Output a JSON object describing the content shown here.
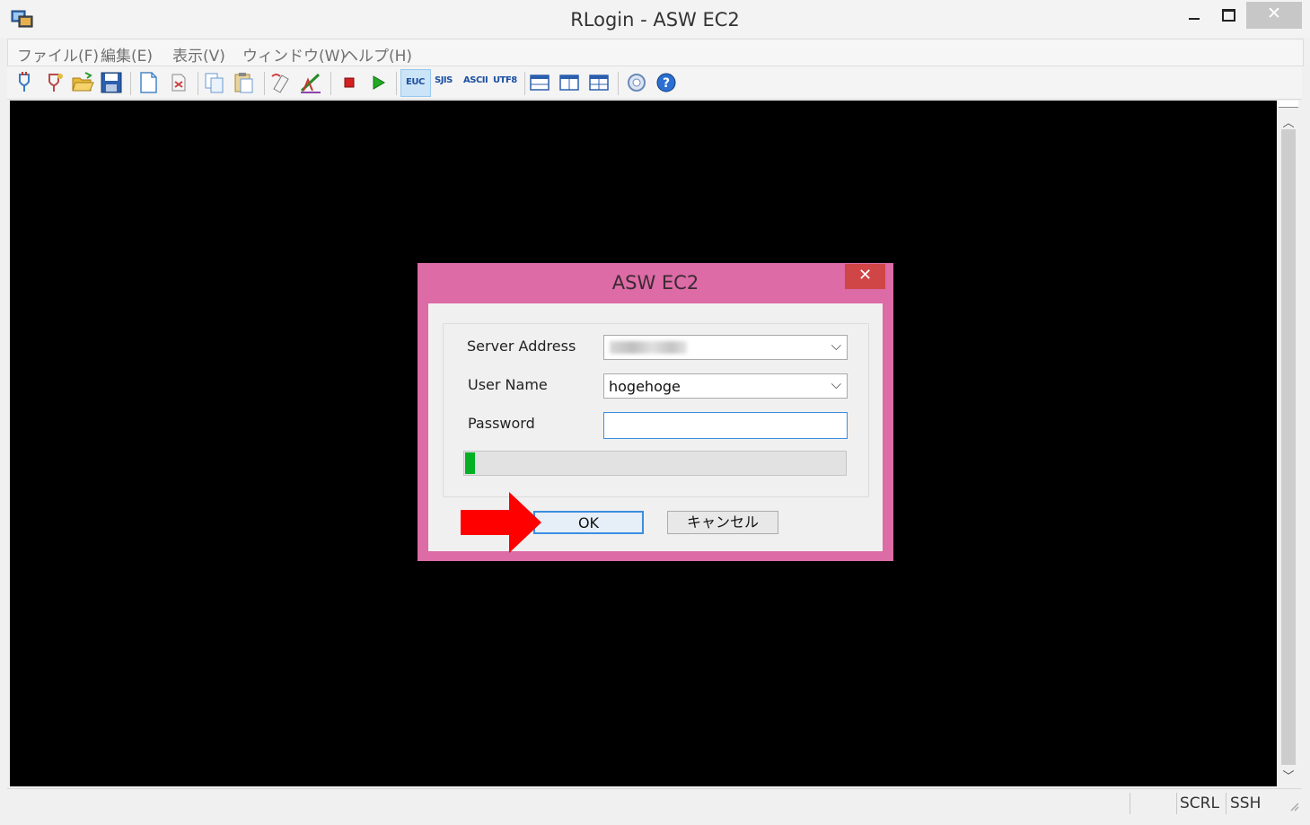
{
  "window": {
    "title": "RLogin - ASW EC2",
    "close_glyph": "✕"
  },
  "menu": [
    {
      "label": "ファイル(F)"
    },
    {
      "label": "編集(E)"
    },
    {
      "label": "表示(V)"
    },
    {
      "label": "ウィンドウ(W)"
    },
    {
      "label": "ヘルプ(H)"
    }
  ],
  "toolbar": {
    "encodings": [
      "EUC",
      "SJIS",
      "ASCII",
      "UTF8"
    ],
    "active_encoding": "EUC"
  },
  "statusbar": {
    "scroll": "SCRL",
    "protocol": "SSH"
  },
  "dialog": {
    "title": "ASW EC2",
    "close_glyph": "✕",
    "server_address_label": "Server Address",
    "server_address_value": "",
    "user_name_label": "User Name",
    "user_name_value": "hogehoge",
    "password_label": "Password",
    "password_value": "",
    "progress_fraction": 0.025,
    "ok_label": "OK",
    "cancel_label": "キャンセル"
  },
  "annotation": {
    "arrow_color": "#ff0000"
  },
  "colors": {
    "dialog_frame": "#dc6ba6",
    "progress_fill": "#06b025",
    "terminal_bg": "#000000"
  }
}
